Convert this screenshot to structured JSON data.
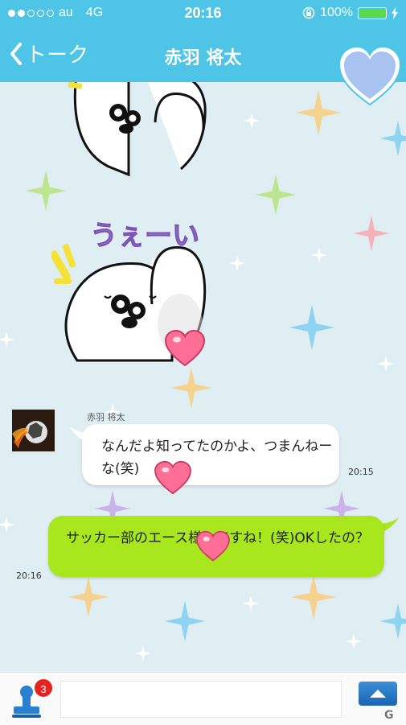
{
  "status_bar": {
    "carrier": "au",
    "network": "4G",
    "time": "20:16",
    "battery": "100%"
  },
  "nav": {
    "back_label": "トーク",
    "title": "赤羽 将太"
  },
  "stickers": {
    "text": "うぇーい"
  },
  "messages": [
    {
      "direction": "incoming",
      "sender": "赤羽 将太",
      "text": "なんだよ知ってたのかよ、つまんねーな(笑)",
      "time": "20:15"
    },
    {
      "direction": "outgoing",
      "text": "サッカー部のエース様々ですね！(笑)OKしたの？",
      "time": "20:16"
    }
  ],
  "footer": {
    "badge_count": "3",
    "input_value": "",
    "input_placeholder": ""
  },
  "colors": {
    "header": "#4ec5e6",
    "outgoing_bubble": "#a8e61e",
    "incoming_bubble": "#ffffff",
    "badge": "#e8231f"
  },
  "icons": [
    "back-chevron-icon",
    "heart-icon",
    "stamp-icon",
    "send-arrow-icon",
    "lock-rotation-icon",
    "battery-icon",
    "charging-icon"
  ]
}
